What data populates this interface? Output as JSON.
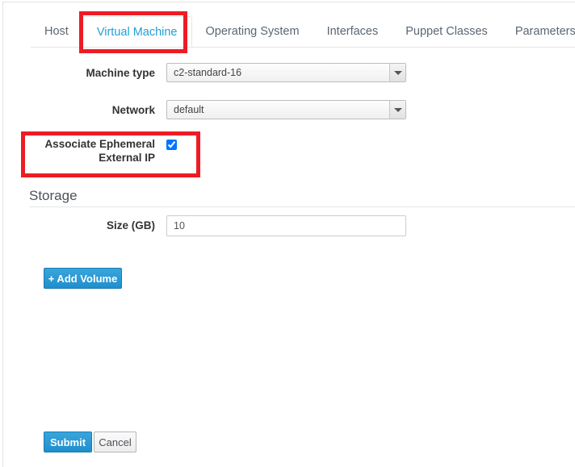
{
  "tabs": [
    {
      "id": "host",
      "label": "Host",
      "active": false
    },
    {
      "id": "virtual-machine",
      "label": "Virtual Machine",
      "active": true
    },
    {
      "id": "operating-system",
      "label": "Operating System",
      "active": false
    },
    {
      "id": "interfaces",
      "label": "Interfaces",
      "active": false
    },
    {
      "id": "puppet-classes",
      "label": "Puppet Classes",
      "active": false
    },
    {
      "id": "parameters",
      "label": "Parameters",
      "active": false
    }
  ],
  "tab_overflow": {
    "icon": "warning-triangle-icon",
    "color": "#ec7a08"
  },
  "form": {
    "machine_type": {
      "label": "Machine type",
      "value": "c2-standard-16",
      "caret_icon": "chevron-down-icon"
    },
    "network": {
      "label": "Network",
      "value": "default",
      "caret_icon": "chevron-down-icon"
    },
    "associate_ephemeral_external_ip": {
      "label_line1": "Associate Ephemeral",
      "label_line2": "External IP",
      "checked": true
    }
  },
  "storage": {
    "heading": "Storage",
    "size": {
      "label": "Size (GB)",
      "value": "10",
      "placeholder": ""
    },
    "add_volume_label": "+ Add Volume"
  },
  "actions": {
    "submit_label": "Submit",
    "cancel_label": "Cancel"
  },
  "annotations": {
    "highlight_color": "#ed1c24",
    "boxes": [
      {
        "target": "virtual-machine-tab"
      },
      {
        "target": "associate-ephemeral-external-ip-row"
      }
    ]
  },
  "colors": {
    "accent_blue": "#21a0d4",
    "primary_button": "#1f8fcc",
    "tab_text": "#5a6673",
    "heading": "#4d5258"
  }
}
